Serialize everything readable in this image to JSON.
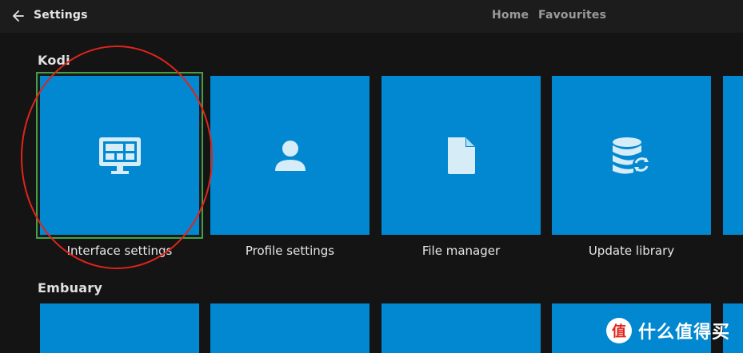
{
  "header": {
    "back_icon": "arrow-left-icon",
    "title": "Settings",
    "nav": [
      {
        "label": "Home"
      },
      {
        "label": "Favourites"
      }
    ]
  },
  "sections": [
    {
      "title": "Kodi",
      "tiles": [
        {
          "label": "Interface settings",
          "icon": "monitor-icon",
          "focused": true
        },
        {
          "label": "Profile settings",
          "icon": "user-icon"
        },
        {
          "label": "File manager",
          "icon": "file-icon"
        },
        {
          "label": "Update library",
          "icon": "database-sync-icon"
        }
      ]
    },
    {
      "title": "Embuary"
    }
  ],
  "colors": {
    "tile": "#0288d1",
    "focus": "#43a047",
    "annotation": "#e0241b",
    "background": "#141414"
  },
  "watermark": {
    "logo_text": "值",
    "text": "什么值得买"
  }
}
